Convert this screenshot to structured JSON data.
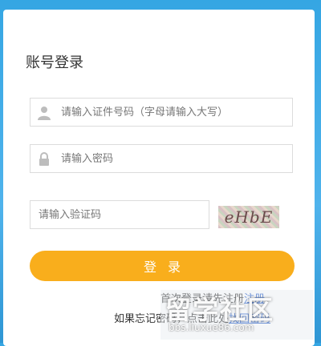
{
  "login": {
    "title": "账号登录",
    "id_placeholder": "请输入证件号码（字母请输入大写）",
    "password_placeholder": "请输入密码",
    "captcha_placeholder": "请输入验证码",
    "captcha_text": "eHbE",
    "login_button": "登录",
    "first_login_text": "首次登录请先注册",
    "register_link": "注册",
    "forgot_text": "如果忘记密码，点击此处",
    "recover_link": "找回密码"
  },
  "watermark": {
    "brand": "留学社区",
    "url": "bbs.liuxue86.com"
  }
}
